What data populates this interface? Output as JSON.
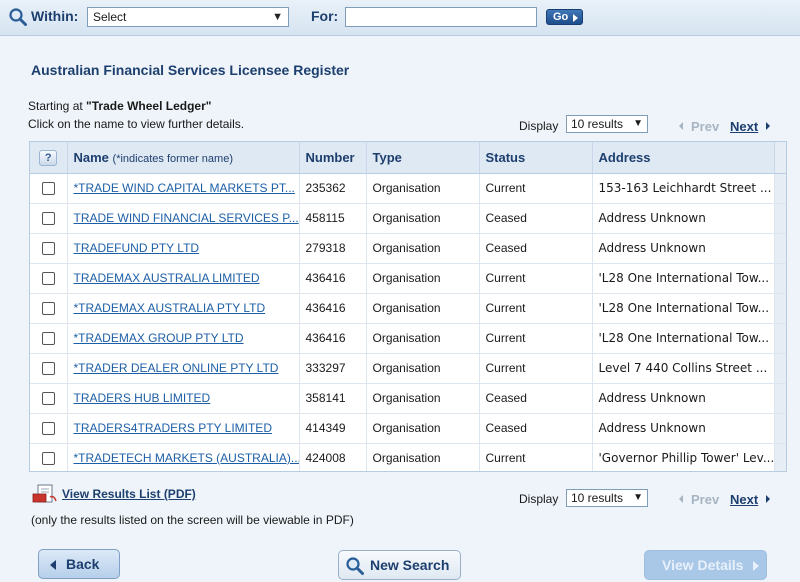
{
  "search": {
    "within_label": "Within:",
    "within_value": "Select",
    "for_label": "For:",
    "for_value": "",
    "go_label": "Go"
  },
  "page_title": "Australian Financial Services Licensee Register",
  "starting_prefix": "Starting at",
  "starting_value": "\"Trade Wheel Ledger\"",
  "click_hint": "Click on the name to view further details.",
  "pager": {
    "display_label": "Display",
    "display_value": "10 results",
    "prev_label": "Prev",
    "next_label": "Next"
  },
  "table": {
    "headers": {
      "help": "?",
      "name": "Name",
      "name_note": "(*indicates former name)",
      "number": "Number",
      "type": "Type",
      "status": "Status",
      "address": "Address"
    },
    "rows": [
      {
        "name": "*TRADE WIND CAPITAL MARKETS PT...",
        "number": "235362",
        "type": "Organisation",
        "status": "Current",
        "address": "153-163 Leichhardt Street ..."
      },
      {
        "name": "TRADE WIND FINANCIAL SERVICES P...",
        "number": "458115",
        "type": "Organisation",
        "status": "Ceased",
        "address": "Address Unknown"
      },
      {
        "name": "TRADEFUND PTY LTD",
        "number": "279318",
        "type": "Organisation",
        "status": "Ceased",
        "address": "Address Unknown"
      },
      {
        "name": "TRADEMAX AUSTRALIA LIMITED",
        "number": "436416",
        "type": "Organisation",
        "status": "Current",
        "address": "'L28 One International Tow..."
      },
      {
        "name": "*TRADEMAX AUSTRALIA PTY LTD",
        "number": "436416",
        "type": "Organisation",
        "status": "Current",
        "address": "'L28 One International Tow..."
      },
      {
        "name": "*TRADEMAX GROUP PTY LTD",
        "number": "436416",
        "type": "Organisation",
        "status": "Current",
        "address": "'L28 One International Tow..."
      },
      {
        "name": "*TRADER DEALER ONLINE PTY LTD",
        "number": "333297",
        "type": "Organisation",
        "status": "Current",
        "address": "Level 7 440 Collins Street ..."
      },
      {
        "name": "TRADERS HUB LIMITED",
        "number": "358141",
        "type": "Organisation",
        "status": "Ceased",
        "address": "Address Unknown"
      },
      {
        "name": "TRADERS4TRADERS PTY LIMITED",
        "number": "414349",
        "type": "Organisation",
        "status": "Ceased",
        "address": "Address Unknown"
      },
      {
        "name": "*TRADETECH MARKETS (AUSTRALIA)...",
        "number": "424008",
        "type": "Organisation",
        "status": "Current",
        "address": "'Governor Phillip Tower' Lev..."
      }
    ]
  },
  "pdf": {
    "link_label": "View Results List (PDF)",
    "note": "(only the results listed on the screen will be viewable in PDF)"
  },
  "buttons": {
    "back": "Back",
    "new_search": "New Search",
    "view_details": "View Details"
  },
  "colors": {
    "brand_navy": "#1d3f6e",
    "link_blue": "#1d5fa7",
    "page_bg": "#eef4fa",
    "disabled_button": "#a9c7e6"
  }
}
